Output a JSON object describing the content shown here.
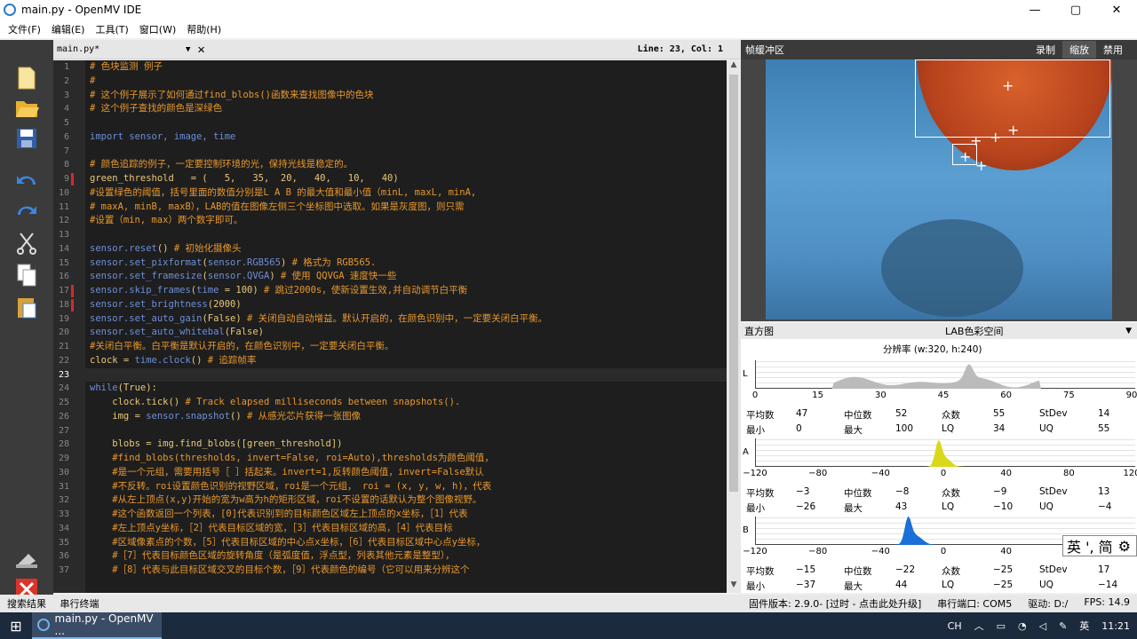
{
  "window": {
    "title": "main.py - OpenMV IDE",
    "minimize": "—",
    "maximize": "▢",
    "close": "✕"
  },
  "menu": [
    "文件(F)",
    "编辑(E)",
    "工具(T)",
    "窗口(W)",
    "帮助(H)"
  ],
  "editor": {
    "filename": "main.py*",
    "position": "Line: 23, Col: 1",
    "current_line": 23,
    "changed_lines": [
      9,
      17,
      18
    ],
    "lines": [
      [
        [
          "cm",
          "# 色块监测 例子"
        ]
      ],
      [
        [
          "cm",
          "#"
        ]
      ],
      [
        [
          "cm",
          "# 这个例子展示了如何通过find_blobs()函数来查找图像中的色块"
        ]
      ],
      [
        [
          "cm",
          "# 这个例子查找的颜色是深绿色"
        ]
      ],
      [],
      [
        [
          "kw",
          "import sensor, image, time"
        ]
      ],
      [],
      [
        [
          "cm",
          "# 颜色追踪的例子，一定要控制环境的光，保持光线是稳定的。"
        ]
      ],
      [
        [
          "tx",
          "green_threshold   = (   5,   35,  20,   40,   10,   40)"
        ]
      ],
      [
        [
          "cm",
          "#设置绿色的阈值，括号里面的数值分别是L A B 的最大值和最小值（minL, maxL, minA,"
        ]
      ],
      [
        [
          "cm",
          "# maxA, minB, maxB），LAB的值在图像左侧三个坐标图中选取。如果是灰度图，则只需"
        ]
      ],
      [
        [
          "cm",
          "#设置（min, max）两个数字即可。"
        ]
      ],
      [],
      [
        [
          "kw",
          "sensor.reset"
        ],
        [
          "tx",
          "() "
        ],
        [
          "cm",
          "# 初始化摄像头"
        ]
      ],
      [
        [
          "kw",
          "sensor.set_pixformat"
        ],
        [
          "tx",
          "("
        ],
        [
          "kw",
          "sensor.RGB565"
        ],
        [
          "tx",
          ") "
        ],
        [
          "cm",
          "# 格式为 RGB565."
        ]
      ],
      [
        [
          "kw",
          "sensor.set_framesize"
        ],
        [
          "tx",
          "("
        ],
        [
          "kw",
          "sensor.QVGA"
        ],
        [
          "tx",
          ") "
        ],
        [
          "cm",
          "# 使用 QQVGA 速度快一些"
        ]
      ],
      [
        [
          "kw",
          "sensor.skip_frames"
        ],
        [
          "tx",
          "("
        ],
        [
          "kw",
          "time"
        ],
        [
          "tx",
          " = 100) "
        ],
        [
          "cm",
          "# 跳过2000s，使新设置生效,并自动调节白平衡"
        ]
      ],
      [
        [
          "kw",
          "sensor.set_brightness"
        ],
        [
          "tx",
          "(2000)"
        ]
      ],
      [
        [
          "kw",
          "sensor.set_auto_gain"
        ],
        [
          "tx",
          "(False) "
        ],
        [
          "cm",
          "# 关闭自动自动增益。默认开启的，在颜色识别中，一定要关闭白平衡。"
        ]
      ],
      [
        [
          "kw",
          "sensor.set_auto_whitebal"
        ],
        [
          "tx",
          "(False)"
        ]
      ],
      [
        [
          "cm",
          "#关闭白平衡。白平衡是默认开启的，在颜色识别中，一定要关闭白平衡。"
        ]
      ],
      [
        [
          "tx",
          "clock = "
        ],
        [
          "kw",
          "time.clock"
        ],
        [
          "tx",
          "() "
        ],
        [
          "cm",
          "# 追踪帧率"
        ]
      ],
      [],
      [
        [
          "kw",
          "while"
        ],
        [
          "tx",
          "(True):"
        ]
      ],
      [
        [
          "tx",
          "    clock.tick() "
        ],
        [
          "cm",
          "# Track elapsed milliseconds between snapshots()."
        ]
      ],
      [
        [
          "tx",
          "    img = "
        ],
        [
          "kw",
          "sensor.snapshot"
        ],
        [
          "tx",
          "() "
        ],
        [
          "cm",
          "# 从感光芯片获得一张图像"
        ]
      ],
      [],
      [
        [
          "tx",
          "    blobs = img.find_blobs([green_threshold])"
        ]
      ],
      [
        [
          "cm",
          "    #find_blobs(thresholds, invert=False, roi=Auto),thresholds为颜色阈值，"
        ]
      ],
      [
        [
          "cm",
          "    #是一个元组，需要用括号［ ］括起来。invert=1,反转颜色阈值，invert=False默认"
        ]
      ],
      [
        [
          "cm",
          "    #不反转。roi设置颜色识别的视野区域，roi是一个元组， roi = (x, y, w, h)，代表"
        ]
      ],
      [
        [
          "cm",
          "    #从左上顶点(x,y)开始的宽为w高为h的矩形区域，roi不设置的话默认为整个图像视野。"
        ]
      ],
      [
        [
          "cm",
          "    #这个函数返回一个列表，[0]代表识别到的目标颜色区域左上顶点的x坐标，［1］代表"
        ]
      ],
      [
        [
          "cm",
          "    #左上顶点y坐标，［2］代表目标区域的宽，［3］代表目标区域的高，［4］代表目标"
        ]
      ],
      [
        [
          "cm",
          "    #区域像素点的个数，［5］代表目标区域的中心点x坐标，［6］代表目标区域中心点y坐标，"
        ]
      ],
      [
        [
          "cm",
          "    #［7］代表目标颜色区域的旋转角度（是弧度值，浮点型，列表其他元素是整型），"
        ]
      ],
      [
        [
          "cm",
          "    #［8］代表与此目标区域交叉的目标个数，［9］代表颜色的编号（它可以用来分辨这个"
        ]
      ]
    ]
  },
  "framebuffer": {
    "label": "帧缓冲区",
    "buttons": [
      "录制",
      "缩放",
      "禁用"
    ],
    "active": "缩放"
  },
  "histogram": {
    "label": "直方图",
    "colorspace": "LAB色彩空间",
    "resolution": "分辨率 (w:320, h:240)",
    "channels": [
      {
        "name": "L",
        "ticks": [
          "0",
          "15",
          "30",
          "45",
          "60",
          "75",
          "90"
        ],
        "color": "#bbbbbb",
        "stats": [
          [
            "平均数",
            "47",
            "中位数",
            "52",
            "众数",
            "55",
            "StDev",
            "14"
          ],
          [
            "最小",
            "0",
            "最大",
            "100",
            "LQ",
            "34",
            "UQ",
            "55"
          ]
        ]
      },
      {
        "name": "A",
        "ticks": [
          "−120",
          "−80",
          "−40",
          "0",
          "40",
          "80",
          "120"
        ],
        "color": "#d9d91a",
        "stats": [
          [
            "平均数",
            "−3",
            "中位数",
            "−8",
            "众数",
            "−9",
            "StDev",
            "13"
          ],
          [
            "最小",
            "−26",
            "最大",
            "43",
            "LQ",
            "−10",
            "UQ",
            "−4"
          ]
        ]
      },
      {
        "name": "B",
        "ticks": [
          "−120",
          "−80",
          "−40",
          "0",
          "40",
          "80",
          "120"
        ],
        "color": "#1a6fd9",
        "stats": [
          [
            "平均数",
            "−15",
            "中位数",
            "−22",
            "众数",
            "−25",
            "StDev",
            "17"
          ],
          [
            "最小",
            "−37",
            "最大",
            "44",
            "LQ",
            "−25",
            "UQ",
            "−14"
          ]
        ]
      }
    ]
  },
  "ime": "英 ', 简",
  "status": {
    "left": [
      "搜索结果",
      "串行终端"
    ],
    "firmware": "固件版本: 2.9.0- [过时 - 点击此处升级]",
    "serial": "串行端口: COM5",
    "drive": "驱动: D:/",
    "fps": "FPS:  14.9"
  },
  "taskbar": {
    "app": "main.py - OpenMV ...",
    "lang": "CH",
    "ime": "英",
    "time": "11:21"
  }
}
